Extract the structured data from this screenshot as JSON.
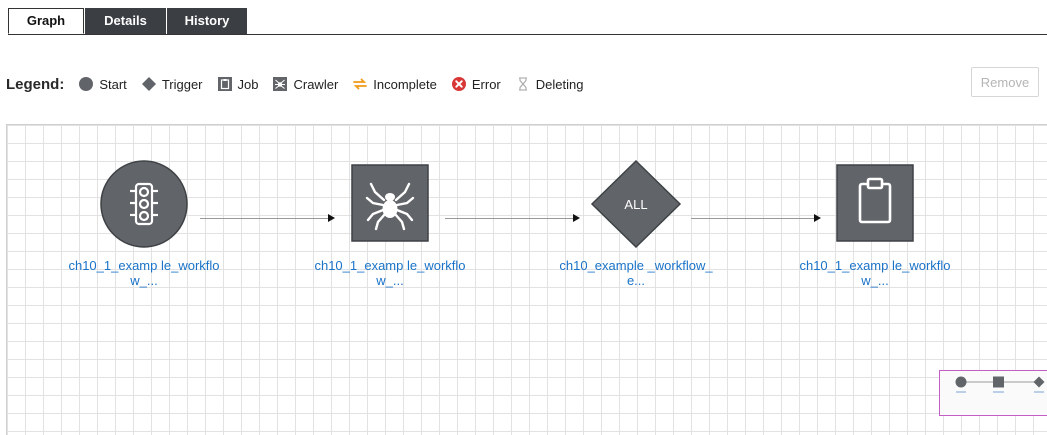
{
  "tabs": [
    {
      "label": "Graph",
      "active": true
    },
    {
      "label": "Details",
      "active": false
    },
    {
      "label": "History",
      "active": false
    }
  ],
  "legend": {
    "title": "Legend:",
    "items": [
      {
        "label": "Start",
        "icon": "circle-icon"
      },
      {
        "label": "Trigger",
        "icon": "diamond-icon"
      },
      {
        "label": "Job",
        "icon": "clipboard-icon"
      },
      {
        "label": "Crawler",
        "icon": "spider-icon"
      },
      {
        "label": "Incomplete",
        "icon": "incomplete-icon"
      },
      {
        "label": "Error",
        "icon": "error-icon"
      },
      {
        "label": "Deleting",
        "icon": "hourglass-icon"
      }
    ]
  },
  "toolbar": {
    "remove_label": "Remove"
  },
  "graph": {
    "nodes": [
      {
        "type": "start",
        "label": "ch10_1_examp le_workflow_...",
        "icon": "traffic-light-icon"
      },
      {
        "type": "crawler",
        "label": "ch10_1_examp le_workflow_...",
        "icon": "spider-icon"
      },
      {
        "type": "trigger",
        "label": "ch10_example _workflow_e...",
        "shape_text": "ALL"
      },
      {
        "type": "job",
        "label": "ch10_1_examp le_workflow_...",
        "icon": "clipboard-icon"
      }
    ]
  },
  "colors": {
    "node_fill": "#616468",
    "link": "#1a73c8",
    "tab_dark": "#3b3e43",
    "incomplete": "#f09a1a",
    "error": "#d93636",
    "minimap_border": "#c45ec4"
  }
}
